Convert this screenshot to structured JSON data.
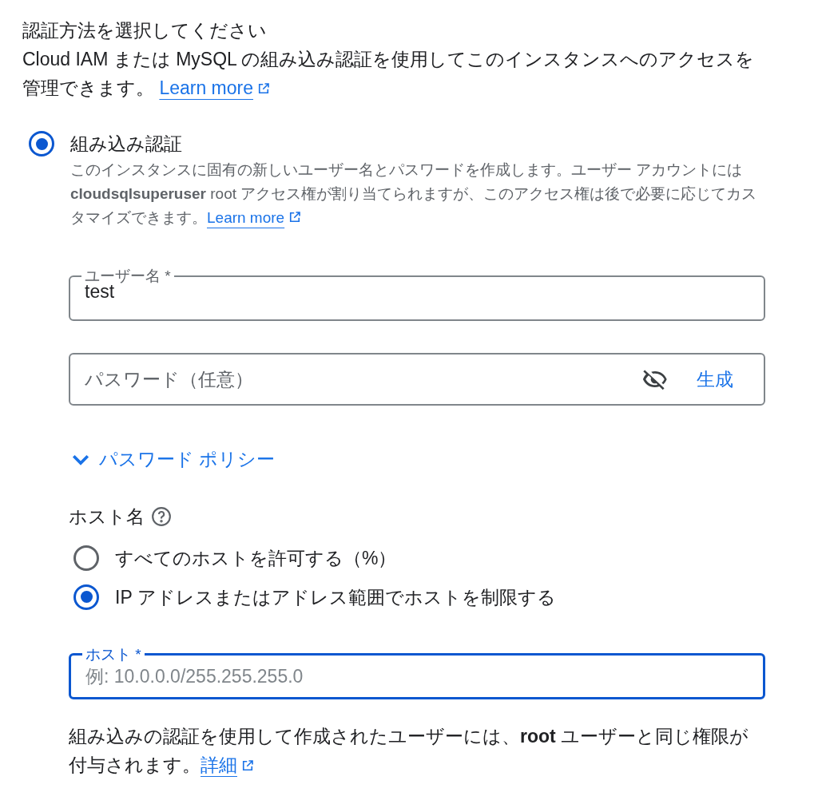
{
  "heading": "認証方法を選択してください",
  "intro": {
    "text": "Cloud IAM または MySQL の組み込み認証を使用してこのインスタンスへのアクセスを管理できます。",
    "link": "Learn more"
  },
  "auth_options": [
    {
      "label": "組み込み認証",
      "selected": true,
      "description": "このインスタンスに固有の新しいユーザー名とパスワードを作成します。ユーザー アカウントには **cloudsqlsuperuser** root アクセス権が割り当てられますが、このアクセス権は後で必要に応じてカスタマイズできます。",
      "link": "Learn more"
    }
  ],
  "username_field": {
    "label": "ユーザー名 *",
    "value": "test",
    "focused": false
  },
  "password_field": {
    "placeholder": "パスワード（任意）",
    "generate_button": "生成"
  },
  "password_policy": {
    "label": "パスワード ポリシー",
    "expanded": false
  },
  "host_name": {
    "label": "ホスト名",
    "options": [
      {
        "label": "すべてのホストを許可する（%）",
        "selected": false
      },
      {
        "label": "IP アドレスまたはアドレス範囲でホストを制限する",
        "selected": true
      }
    ]
  },
  "host_field": {
    "label": "ホスト *",
    "placeholder": "例: 10.0.0.0/255.255.255.0",
    "focused": true
  },
  "footer": {
    "text": "組み込みの認証を使用して作成されたユーザーには、**root** ユーザーと同じ権限が付与されます。",
    "link": "詳細"
  }
}
